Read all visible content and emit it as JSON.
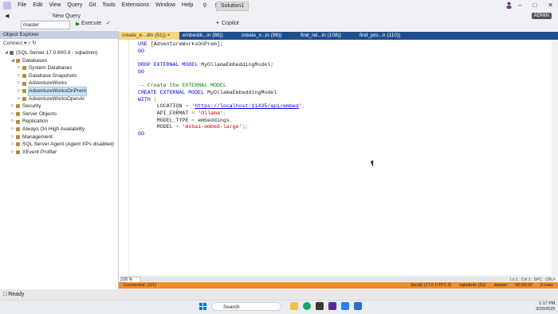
{
  "menu": [
    "File",
    "Edit",
    "View",
    "Query",
    "Git",
    "Tools",
    "Extensions",
    "Window",
    "Help"
  ],
  "search_label": "Search",
  "solution_label": "Solution1",
  "toolbar": {
    "new_query": "New Query",
    "database": "master",
    "execute": "Execute",
    "copilot": "Copilot"
  },
  "admin_badge": "ADMIN",
  "object_explorer": {
    "title": "Object Explorer",
    "connect": "Connect",
    "tree": [
      {
        "label": "(SQL Server 17.0.600.9 - sqladmin)",
        "level": 0,
        "expanded": true,
        "icon": "server"
      },
      {
        "label": "Databases",
        "level": 1,
        "expanded": true,
        "icon": "folder"
      },
      {
        "label": "System Databases",
        "level": 2,
        "expanded": false,
        "icon": "folder"
      },
      {
        "label": "Database Snapshots",
        "level": 2,
        "expanded": false,
        "icon": "folder"
      },
      {
        "label": "AdventureWorks",
        "level": 2,
        "expanded": false,
        "icon": "database"
      },
      {
        "label": "AdventureWorksOnPrem",
        "level": 2,
        "expanded": false,
        "icon": "database",
        "selected": true
      },
      {
        "label": "AdventureWorksOpenAI",
        "level": 2,
        "expanded": false,
        "icon": "database"
      },
      {
        "label": "Security",
        "level": 1,
        "expanded": false,
        "icon": "folder"
      },
      {
        "label": "Server Objects",
        "level": 1,
        "expanded": false,
        "icon": "folder"
      },
      {
        "label": "Replication",
        "level": 1,
        "expanded": false,
        "icon": "folder"
      },
      {
        "label": "Always On High Availability",
        "level": 1,
        "expanded": false,
        "icon": "folder"
      },
      {
        "label": "Management",
        "level": 1,
        "expanded": false,
        "icon": "folder"
      },
      {
        "label": "SQL Server Agent (Agent XPs disabled)",
        "level": 1,
        "expanded": false,
        "icon": "agent"
      },
      {
        "label": "XEvent Profiler",
        "level": 1,
        "expanded": false,
        "icon": "folder"
      }
    ]
  },
  "tabs": [
    "create_e...din (51))",
    "embeddi...in (88))",
    "create_v...in (96))",
    "find_rel...in (108))",
    "find_pro...n (110))"
  ],
  "code_lines": [
    [
      {
        "t": "USE ",
        "c": "kw"
      },
      {
        "t": "[AdventureWorksOnPrem];",
        "c": ""
      }
    ],
    [
      {
        "t": "GO",
        "c": "kw"
      }
    ],
    [],
    [
      {
        "t": "DROP EXTERNAL MODEL ",
        "c": "kw"
      },
      {
        "t": "MyOllamaEmbeddingModel;",
        "c": ""
      }
    ],
    [
      {
        "t": "GO",
        "c": "kw"
      }
    ],
    [],
    [
      {
        "t": "-- Create the EXTERNAL MODEL",
        "c": "cm"
      }
    ],
    [
      {
        "t": "CREATE EXTERNAL MODEL ",
        "c": "kw"
      },
      {
        "t": "MyOllamaEmbeddingModel",
        "c": ""
      }
    ],
    [
      {
        "t": "WITH ",
        "c": "kw"
      },
      {
        "t": "(",
        "c": "gy"
      }
    ],
    [
      {
        "t": "      LOCATION ",
        "c": ""
      },
      {
        "t": "= ",
        "c": "gy"
      },
      {
        "t": "'",
        "c": "st"
      },
      {
        "t": "https://localhost:11435/api/embed",
        "c": "url"
      },
      {
        "t": "'",
        "c": "st"
      },
      {
        "t": ",",
        "c": "gy"
      }
    ],
    [
      {
        "t": "      API_FORMAT ",
        "c": ""
      },
      {
        "t": "= ",
        "c": "gy"
      },
      {
        "t": "'Ollama'",
        "c": "st"
      },
      {
        "t": ",",
        "c": "gy"
      }
    ],
    [
      {
        "t": "      MODEL_TYPE ",
        "c": ""
      },
      {
        "t": "= ",
        "c": "gy"
      },
      {
        "t": "embeddings",
        "c": ""
      },
      {
        "t": ",",
        "c": "gy"
      }
    ],
    [
      {
        "t": "      MODEL ",
        "c": ""
      },
      {
        "t": "= ",
        "c": "gy"
      },
      {
        "t": "'mxbai-embed-large'",
        "c": "st"
      },
      {
        "t": ");",
        "c": "gy"
      }
    ],
    [
      {
        "t": "GO",
        "c": "kw"
      }
    ]
  ],
  "zoom": "100 %",
  "query_status": {
    "left": "Connected. (1/1)",
    "right": [
      "(local) (17.0 CTP1.3)",
      "sqladmin (51)",
      "master",
      "00:00:00",
      "0 rows"
    ]
  },
  "editor_pos": {
    "ln": "Ln 1",
    "col": "Col 1",
    "mode": "SPC",
    "eol": "CRLF"
  },
  "app_status": "Ready",
  "taskbar": {
    "search": "Search",
    "time": "1:17 PM",
    "date": "3/20/2025"
  },
  "colors": {
    "tab_bar": "#1f4e8c",
    "active_tab": "#f7d77d",
    "status_orange": "#f28c28",
    "keyword": "#0000ff",
    "comment": "#008000",
    "string": "#c00000"
  }
}
